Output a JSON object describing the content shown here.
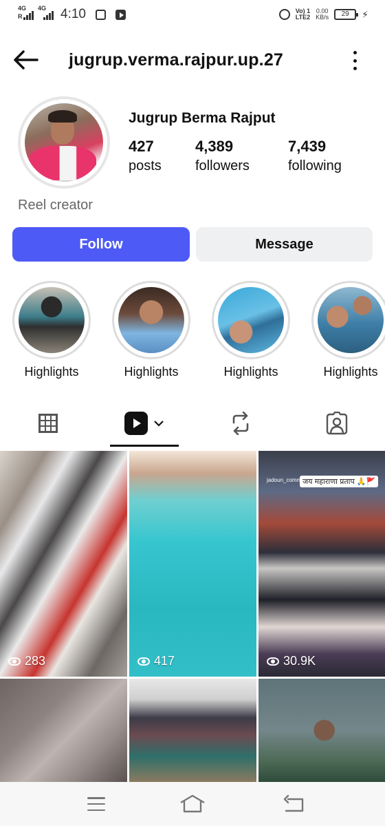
{
  "status_bar": {
    "network1": "4G",
    "roaming": "R",
    "network2": "4G",
    "time": "4:10",
    "volte_line1": "Vo) 1",
    "volte_line2": "LTE2",
    "speed_value": "0.00",
    "speed_unit": "KB/s",
    "battery": "29"
  },
  "header": {
    "username": "jugrup.verma.rajpur.up.27",
    "back_icon": "arrow-left-icon",
    "menu_icon": "more-vertical-icon"
  },
  "profile": {
    "full_name": "Jugrup Berma Rajput",
    "stats": [
      {
        "value": "427",
        "label": "posts"
      },
      {
        "value": "4,389",
        "label": "followers"
      },
      {
        "value": "7,439",
        "label": "following"
      }
    ],
    "bio": "Reel creator"
  },
  "actions": {
    "follow_label": "Follow",
    "message_label": "Message",
    "follow_color": "#4d5af5"
  },
  "highlights": [
    {
      "label": "Highlights"
    },
    {
      "label": "Highlights"
    },
    {
      "label": "Highlights"
    },
    {
      "label": "Highlights"
    }
  ],
  "tabs": [
    {
      "name": "grid",
      "icon": "grid-icon"
    },
    {
      "name": "reels",
      "icon": "reels-icon",
      "active": true
    },
    {
      "name": "reposts",
      "icon": "repost-icon"
    },
    {
      "name": "tagged",
      "icon": "tagged-person-icon"
    }
  ],
  "posts": [
    {
      "views": "283"
    },
    {
      "views": "417"
    },
    {
      "views": "30.9K",
      "overlay_text": "जय महाराणा प्रताप 🙏🚩",
      "tag": "jadoun_commu"
    },
    {
      "views": ""
    },
    {
      "views": ""
    },
    {
      "views": ""
    }
  ],
  "nav_bar": {
    "icons": [
      "menu-icon",
      "home-icon",
      "back-icon"
    ]
  }
}
